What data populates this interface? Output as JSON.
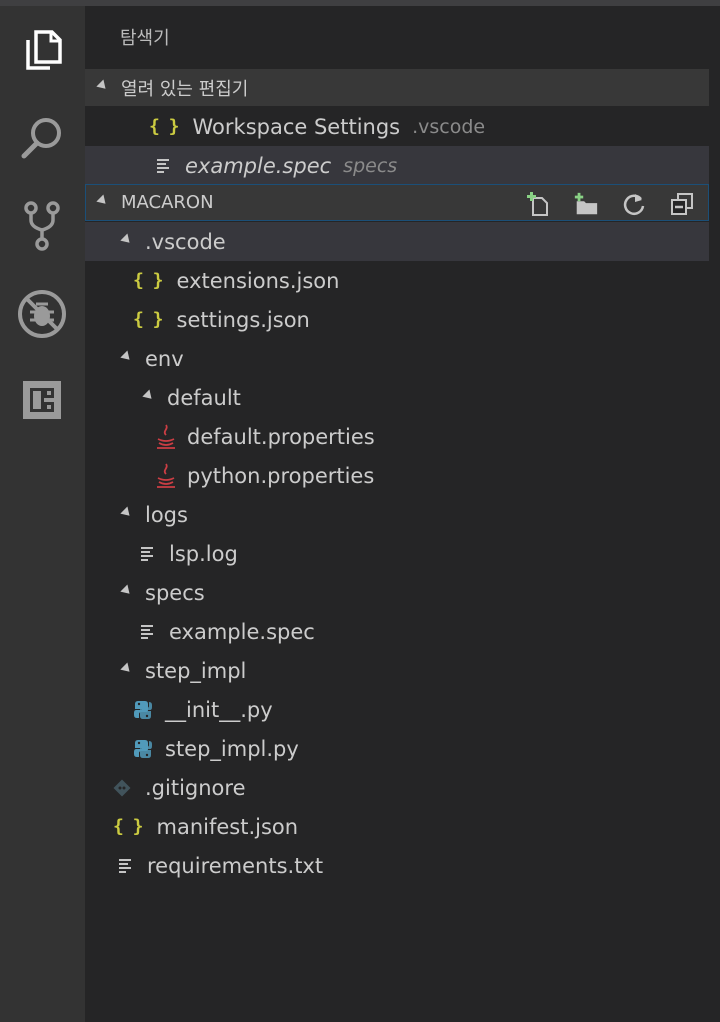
{
  "explorer": {
    "title": "탐색기",
    "open_editors": {
      "label": "열려 있는 편집기",
      "items": [
        {
          "name": "Workspace Settings",
          "desc": ".vscode",
          "icon": "json-braces-icon",
          "italic": false
        },
        {
          "name": "example.spec",
          "desc": "specs",
          "icon": "text-file-icon",
          "italic": true
        }
      ]
    },
    "project": {
      "label": "MACARON",
      "actions": [
        "new-file-icon",
        "new-folder-icon",
        "refresh-icon",
        "collapse-all-icon"
      ]
    },
    "tree": [
      {
        "label": ".vscode",
        "type": "folder"
      },
      {
        "label": "extensions.json",
        "type": "json"
      },
      {
        "label": "settings.json",
        "type": "json"
      },
      {
        "label": "env",
        "type": "folder"
      },
      {
        "label": "default",
        "type": "folder"
      },
      {
        "label": "default.properties",
        "type": "java"
      },
      {
        "label": "python.properties",
        "type": "java"
      },
      {
        "label": "logs",
        "type": "folder"
      },
      {
        "label": "lsp.log",
        "type": "text"
      },
      {
        "label": "specs",
        "type": "folder"
      },
      {
        "label": "example.spec",
        "type": "text"
      },
      {
        "label": "step_impl",
        "type": "folder"
      },
      {
        "label": "__init__.py",
        "type": "python"
      },
      {
        "label": "step_impl.py",
        "type": "python"
      },
      {
        "label": ".gitignore",
        "type": "git"
      },
      {
        "label": "manifest.json",
        "type": "json"
      },
      {
        "label": "requirements.txt",
        "type": "text"
      }
    ]
  },
  "activity_bar": [
    "explorer-icon",
    "search-icon",
    "source-control-icon",
    "debug-icon",
    "extensions-icon"
  ],
  "colors": {
    "json": "#cbcb41",
    "java": "#cc3e44",
    "python": "#519aba",
    "git": "#41535b",
    "accent": "#1b4f78"
  }
}
